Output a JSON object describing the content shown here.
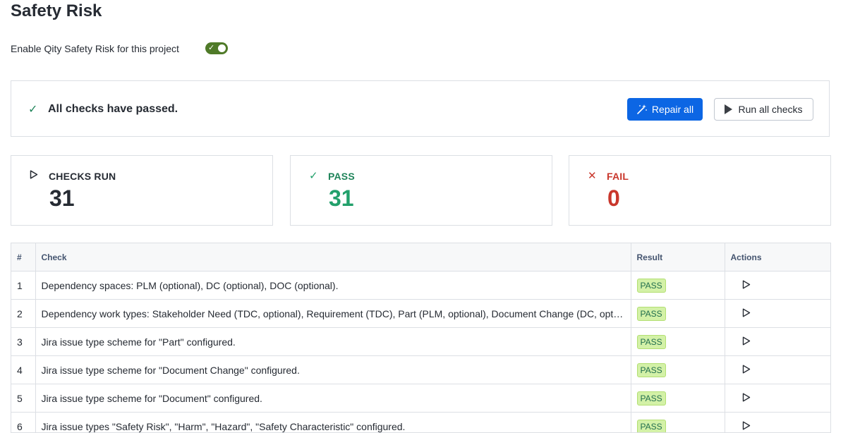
{
  "page": {
    "title": "Safety Risk"
  },
  "settings": {
    "enable_label": "Enable Qity Safety Risk for this project",
    "enabled": true
  },
  "status": {
    "message": "All checks have passed.",
    "repair_label": "Repair all",
    "run_all_label": "Run all checks"
  },
  "stats": {
    "checks_run": {
      "label": "CHECKS RUN",
      "value": "31",
      "icon": "play-outline-icon"
    },
    "pass": {
      "label": "PASS",
      "value": "31",
      "icon": "check-icon",
      "color": "#22a06b"
    },
    "fail": {
      "label": "FAIL",
      "value": "0",
      "icon": "x-icon",
      "color": "#c9372c"
    }
  },
  "table": {
    "headers": {
      "num": "#",
      "check": "Check",
      "result": "Result",
      "actions": "Actions"
    },
    "rows": [
      {
        "num": "1",
        "check": "Dependency spaces: PLM (optional), DC (optional), DOC (optional).",
        "result": "PASS"
      },
      {
        "num": "2",
        "check": "Dependency work types: Stakeholder Need (TDC, optional), Requirement (TDC), Part (PLM, optional), Document Change (DC, optional), Document (DOC, optional).",
        "result": "PASS"
      },
      {
        "num": "3",
        "check": "Jira issue type scheme for \"Part\" configured.",
        "result": "PASS"
      },
      {
        "num": "4",
        "check": "Jira issue type scheme for \"Document Change\" configured.",
        "result": "PASS"
      },
      {
        "num": "5",
        "check": "Jira issue type scheme for \"Document\" configured.",
        "result": "PASS"
      },
      {
        "num": "6",
        "check": "Jira issue types \"Safety Risk\", \"Harm\", \"Hazard\", \"Safety Characteristic\" configured.",
        "result": "PASS"
      }
    ]
  }
}
